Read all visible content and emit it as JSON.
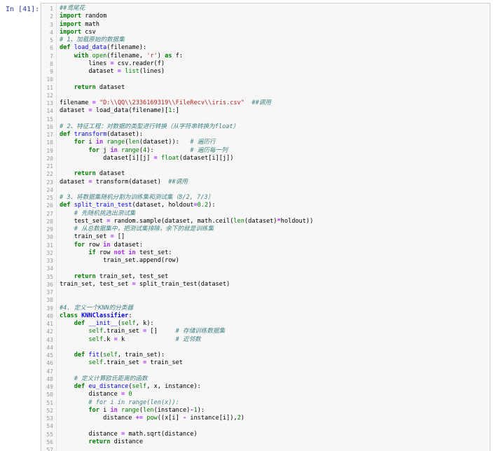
{
  "cell": {
    "prompt": "In  [41]:"
  },
  "code_lines": [
    [
      {
        "t": "##鸢尾花",
        "c": "cm"
      }
    ],
    [
      {
        "t": "import",
        "c": "kw"
      },
      {
        "t": " random"
      }
    ],
    [
      {
        "t": "import",
        "c": "kw"
      },
      {
        "t": " math"
      }
    ],
    [
      {
        "t": "import",
        "c": "kw"
      },
      {
        "t": " csv"
      }
    ],
    [
      {
        "t": "# 1、加载原始的数据集",
        "c": "cm"
      }
    ],
    [
      {
        "t": "def",
        "c": "kw"
      },
      {
        "t": " "
      },
      {
        "t": "load_data",
        "c": "fn"
      },
      {
        "t": "(filename):"
      }
    ],
    [
      {
        "t": "    "
      },
      {
        "t": "with",
        "c": "kw"
      },
      {
        "t": " "
      },
      {
        "t": "open",
        "c": "bi"
      },
      {
        "t": "(filename, "
      },
      {
        "t": "'r'",
        "c": "str"
      },
      {
        "t": ") "
      },
      {
        "t": "as",
        "c": "kw"
      },
      {
        "t": " f:"
      }
    ],
    [
      {
        "t": "        lines "
      },
      {
        "t": "=",
        "c": "op"
      },
      {
        "t": " csv.reader(f)"
      }
    ],
    [
      {
        "t": "        dataset "
      },
      {
        "t": "=",
        "c": "op"
      },
      {
        "t": " "
      },
      {
        "t": "list",
        "c": "bi"
      },
      {
        "t": "(lines)"
      }
    ],
    [],
    [
      {
        "t": "    "
      },
      {
        "t": "return",
        "c": "kw"
      },
      {
        "t": " dataset"
      }
    ],
    [],
    [
      {
        "t": "filename "
      },
      {
        "t": "=",
        "c": "op"
      },
      {
        "t": " "
      },
      {
        "t": "\"D:\\\\QQ\\\\2336169319\\\\FileRecv\\\\iris.csv\"",
        "c": "str"
      },
      {
        "t": "  "
      },
      {
        "t": "##调用",
        "c": "cm"
      }
    ],
    [
      {
        "t": "dataset "
      },
      {
        "t": "=",
        "c": "op"
      },
      {
        "t": " load_data(filename)["
      },
      {
        "t": "1",
        "c": "num"
      },
      {
        "t": ":]"
      }
    ],
    [],
    [
      {
        "t": "# 2、特征工程：对数据的类型进行转换（从字符串转换为float）",
        "c": "cm"
      }
    ],
    [
      {
        "t": "def",
        "c": "kw"
      },
      {
        "t": " "
      },
      {
        "t": "transform",
        "c": "fn"
      },
      {
        "t": "(dataset):"
      }
    ],
    [
      {
        "t": "    "
      },
      {
        "t": "for",
        "c": "kw"
      },
      {
        "t": " i "
      },
      {
        "t": "in",
        "c": "op"
      },
      {
        "t": " "
      },
      {
        "t": "range",
        "c": "bi"
      },
      {
        "t": "("
      },
      {
        "t": "len",
        "c": "bi"
      },
      {
        "t": "(dataset)):   "
      },
      {
        "t": "# 遍历行",
        "c": "cm"
      }
    ],
    [
      {
        "t": "        "
      },
      {
        "t": "for",
        "c": "kw"
      },
      {
        "t": " j "
      },
      {
        "t": "in",
        "c": "op"
      },
      {
        "t": " "
      },
      {
        "t": "range",
        "c": "bi"
      },
      {
        "t": "("
      },
      {
        "t": "4",
        "c": "num"
      },
      {
        "t": "):          "
      },
      {
        "t": "# 遍历每一列",
        "c": "cm"
      }
    ],
    [
      {
        "t": "            dataset[i][j] "
      },
      {
        "t": "=",
        "c": "op"
      },
      {
        "t": " "
      },
      {
        "t": "float",
        "c": "bi"
      },
      {
        "t": "(dataset[i][j])"
      }
    ],
    [],
    [
      {
        "t": "    "
      },
      {
        "t": "return",
        "c": "kw"
      },
      {
        "t": " dataset"
      }
    ],
    [
      {
        "t": "dataset "
      },
      {
        "t": "=",
        "c": "op"
      },
      {
        "t": " transform(dataset)  "
      },
      {
        "t": "##调用",
        "c": "cm"
      }
    ],
    [],
    [
      {
        "t": "# 3、将数据集随机分割为训练集和测试集（8/2, 7/3）",
        "c": "cm"
      }
    ],
    [
      {
        "t": "def",
        "c": "kw"
      },
      {
        "t": " "
      },
      {
        "t": "split_train_test",
        "c": "fn"
      },
      {
        "t": "(dataset, holdout"
      },
      {
        "t": "=",
        "c": "op"
      },
      {
        "t": "0.2",
        "c": "num"
      },
      {
        "t": "):"
      }
    ],
    [
      {
        "t": "    "
      },
      {
        "t": "# 先随机挑选出测试集",
        "c": "cm"
      }
    ],
    [
      {
        "t": "    test_set "
      },
      {
        "t": "=",
        "c": "op"
      },
      {
        "t": " random.sample(dataset, math.ceil("
      },
      {
        "t": "len",
        "c": "bi"
      },
      {
        "t": "(dataset)"
      },
      {
        "t": "*",
        "c": "op"
      },
      {
        "t": "holdout))"
      }
    ],
    [
      {
        "t": "    "
      },
      {
        "t": "# 从总数据集中，把测试集排除，余下的就是训练集",
        "c": "cm"
      }
    ],
    [
      {
        "t": "    train_set "
      },
      {
        "t": "=",
        "c": "op"
      },
      {
        "t": " []"
      }
    ],
    [
      {
        "t": "    "
      },
      {
        "t": "for",
        "c": "kw"
      },
      {
        "t": " row "
      },
      {
        "t": "in",
        "c": "op"
      },
      {
        "t": " dataset:"
      }
    ],
    [
      {
        "t": "        "
      },
      {
        "t": "if",
        "c": "kw"
      },
      {
        "t": " row "
      },
      {
        "t": "not",
        "c": "op"
      },
      {
        "t": " "
      },
      {
        "t": "in",
        "c": "op"
      },
      {
        "t": " test_set:"
      }
    ],
    [
      {
        "t": "            train_set.append(row)"
      }
    ],
    [],
    [
      {
        "t": "    "
      },
      {
        "t": "return",
        "c": "kw"
      },
      {
        "t": " train_set, test_set"
      }
    ],
    [
      {
        "t": "train_set, test_set "
      },
      {
        "t": "=",
        "c": "op"
      },
      {
        "t": " split_train_test(dataset)"
      }
    ],
    [],
    [],
    [
      {
        "t": "#4. 定义一个KNN的分类器",
        "c": "cm"
      }
    ],
    [
      {
        "t": "class",
        "c": "kw"
      },
      {
        "t": " "
      },
      {
        "t": "KNNClassifier",
        "c": "cls"
      },
      {
        "t": ":"
      }
    ],
    [
      {
        "t": "    "
      },
      {
        "t": "def",
        "c": "kw"
      },
      {
        "t": " "
      },
      {
        "t": "__init__",
        "c": "fn"
      },
      {
        "t": "("
      },
      {
        "t": "self",
        "c": "bi"
      },
      {
        "t": ", k):"
      }
    ],
    [
      {
        "t": "        "
      },
      {
        "t": "self",
        "c": "bi"
      },
      {
        "t": ".train_set "
      },
      {
        "t": "=",
        "c": "op"
      },
      {
        "t": " []     "
      },
      {
        "t": "# 存储训练数据集",
        "c": "cm"
      }
    ],
    [
      {
        "t": "        "
      },
      {
        "t": "self",
        "c": "bi"
      },
      {
        "t": ".k "
      },
      {
        "t": "=",
        "c": "op"
      },
      {
        "t": " k              "
      },
      {
        "t": "# 近邻数",
        "c": "cm"
      }
    ],
    [],
    [
      {
        "t": "    "
      },
      {
        "t": "def",
        "c": "kw"
      },
      {
        "t": " "
      },
      {
        "t": "fit",
        "c": "fn"
      },
      {
        "t": "("
      },
      {
        "t": "self",
        "c": "bi"
      },
      {
        "t": ", train_set):"
      }
    ],
    [
      {
        "t": "        "
      },
      {
        "t": "self",
        "c": "bi"
      },
      {
        "t": ".train_set "
      },
      {
        "t": "=",
        "c": "op"
      },
      {
        "t": " train_set"
      }
    ],
    [],
    [
      {
        "t": "    "
      },
      {
        "t": "# 定义计算欧氏距离的函数",
        "c": "cm"
      }
    ],
    [
      {
        "t": "    "
      },
      {
        "t": "def",
        "c": "kw"
      },
      {
        "t": " "
      },
      {
        "t": "eu_distance",
        "c": "fn"
      },
      {
        "t": "("
      },
      {
        "t": "self",
        "c": "bi"
      },
      {
        "t": ", x, instance):"
      }
    ],
    [
      {
        "t": "        distance "
      },
      {
        "t": "=",
        "c": "op"
      },
      {
        "t": " "
      },
      {
        "t": "0",
        "c": "num"
      }
    ],
    [
      {
        "t": "        "
      },
      {
        "t": "# for i in range(len(x)):",
        "c": "cm"
      }
    ],
    [
      {
        "t": "        "
      },
      {
        "t": "for",
        "c": "kw"
      },
      {
        "t": " i "
      },
      {
        "t": "in",
        "c": "op"
      },
      {
        "t": " "
      },
      {
        "t": "range",
        "c": "bi"
      },
      {
        "t": "("
      },
      {
        "t": "len",
        "c": "bi"
      },
      {
        "t": "(instance)"
      },
      {
        "t": "-",
        "c": "op"
      },
      {
        "t": "1",
        "c": "num"
      },
      {
        "t": "):"
      }
    ],
    [
      {
        "t": "            distance "
      },
      {
        "t": "+=",
        "c": "op"
      },
      {
        "t": " "
      },
      {
        "t": "pow",
        "c": "bi"
      },
      {
        "t": "((x[i] "
      },
      {
        "t": "-",
        "c": "op"
      },
      {
        "t": " instance[i]),"
      },
      {
        "t": "2",
        "c": "num"
      },
      {
        "t": ")"
      }
    ],
    [],
    [
      {
        "t": "        distance "
      },
      {
        "t": "=",
        "c": "op"
      },
      {
        "t": " math.sqrt(distance)"
      }
    ],
    [
      {
        "t": "        "
      },
      {
        "t": "return",
        "c": "kw"
      },
      {
        "t": " distance"
      }
    ],
    []
  ]
}
